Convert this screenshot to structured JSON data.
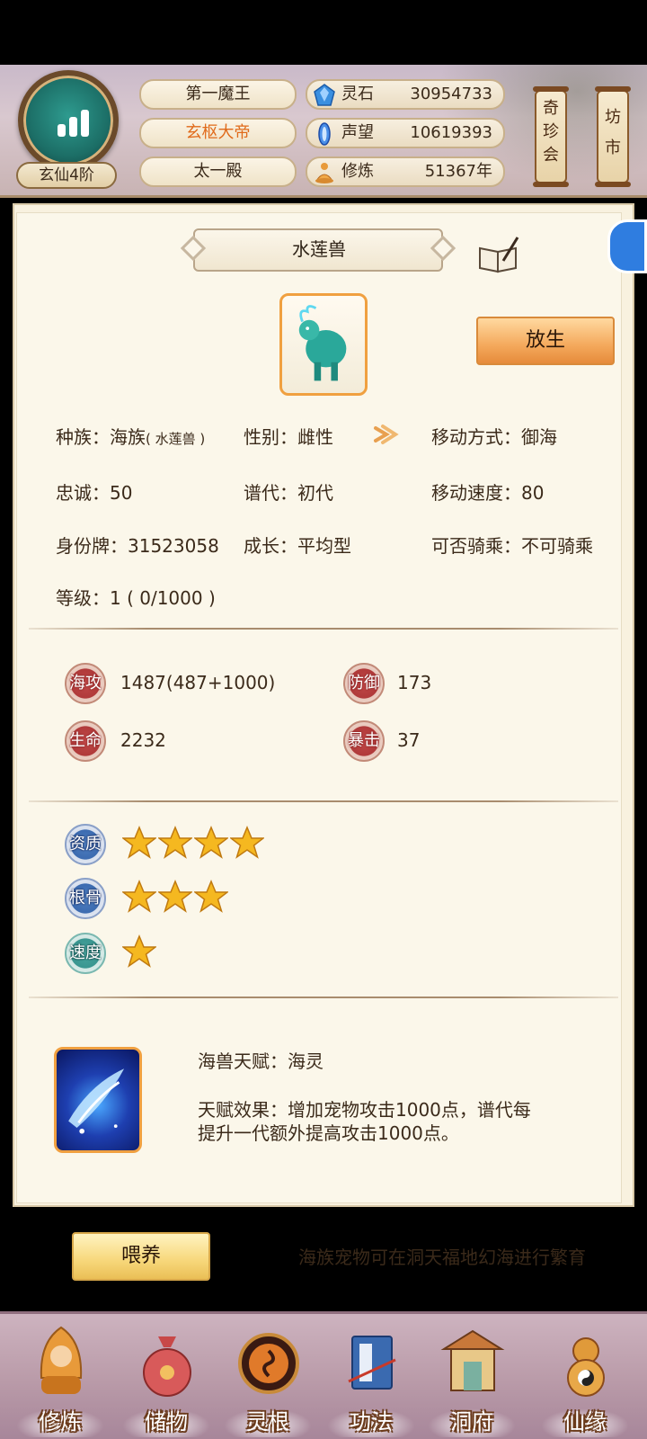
{
  "header": {
    "rank_badge": "玄仙4阶",
    "titles": [
      "第一魔王",
      "玄枢大帝",
      "太一殿"
    ],
    "resources": [
      {
        "icon": "spirit-stone-icon",
        "label": "灵石",
        "value": "30954733"
      },
      {
        "icon": "prestige-crystal-icon",
        "label": "声望",
        "value": "10619393"
      },
      {
        "icon": "meditation-icon",
        "label": "修炼",
        "value": "51367年"
      }
    ],
    "shortcuts": [
      "奇珍会",
      "坊市"
    ]
  },
  "pet": {
    "name": "水莲兽",
    "release_label": "放生",
    "info": {
      "race_label": "种族：",
      "race_value": "海族",
      "race_sub": "( 水莲兽 )",
      "gender": "性别：雌性",
      "move_mode": "移动方式：御海",
      "loyalty": "忠诚：50",
      "generation": "谱代：初代",
      "move_speed": "移动速度：80",
      "id_tag": "身份牌：31523058",
      "growth": "成长：平均型",
      "rideable": "可否骑乘：不可骑乘",
      "level": "等级：1 ( 0/1000 )"
    },
    "stats": [
      {
        "label": "海攻",
        "value": "1487(487+1000)"
      },
      {
        "label": "防御",
        "value": "173"
      },
      {
        "label": "生命",
        "value": "2232"
      },
      {
        "label": "暴击",
        "value": "37"
      }
    ],
    "ratings": [
      {
        "label": "资质",
        "stars": 4
      },
      {
        "label": "根骨",
        "stars": 3
      },
      {
        "label": "速度",
        "stars": 1
      }
    ],
    "talent": {
      "name": "海兽天赋：海灵",
      "effect_line1": "天赋效果：增加宠物攻击1000点，谱代每",
      "effect_line2": "提升一代额外提高攻击1000点。"
    },
    "feed_label": "喂养",
    "tip": "海族宠物可在洞天福地幻海进行繁育"
  },
  "nav": [
    "修炼",
    "储物",
    "灵根",
    "功法",
    "洞府",
    "仙缘"
  ],
  "colors": {
    "accent_orange": "#e68b3b",
    "title_highlight": "#e06a1a",
    "star": "#f5b820",
    "panel_bg": "#fbf7ea"
  }
}
